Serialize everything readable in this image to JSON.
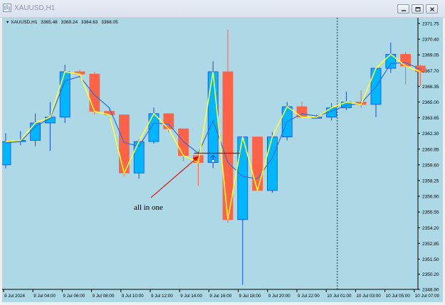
{
  "window": {
    "title": "XAUUSD,H1",
    "buttons": {
      "minimize": "minimize-icon",
      "restore": "restore-icon",
      "close": "close-icon"
    }
  },
  "header": {
    "symbol": "XAUUSD,H1",
    "open": "3365.48",
    "high": "3369.24",
    "low": "3364.63",
    "close": "3368.05"
  },
  "annotation": {
    "text": "all in one",
    "color": "#e00000"
  },
  "colors": {
    "background": "#add8e6",
    "bull_fill": "#00b7ff",
    "bear_fill": "#ff6347",
    "bull_wick": "#1a4ad6",
    "bear_wick": "#ff6347",
    "yellow_line": "#ffff33",
    "blue_line": "#2f6fd6",
    "grid": "#7a9aa8"
  },
  "chart_data": {
    "type": "candlestick",
    "y_ticks": [
      "2371.75",
      "2370.40",
      "2369.05",
      "2367.70",
      "2366.35",
      "2365.00",
      "2363.65",
      "2362.30",
      "2360.95",
      "2359.60",
      "2358.25",
      "2356.90",
      "2355.55",
      "2354.20",
      "2352.85",
      "2351.50",
      "2350.20",
      "2348.90"
    ],
    "x_ticks": [
      "9 Jul 2024",
      "9 Jul 04:00",
      "9 Jul 06:00",
      "9 Jul 08:00",
      "9 Jul 10:00",
      "9 Jul 12:00",
      "9 Jul 14:00",
      "9 Jul 16:00",
      "9 Jul 18:00",
      "9 Jul 20:00",
      "9 Jul 22:00",
      "10 Jul 01:00",
      "10 Jul 03:00",
      "10 Jul 05:00",
      "10 Jul 07:00"
    ],
    "ylim": [
      2348.9,
      2371.75
    ],
    "candles": [
      {
        "o": 2359.6,
        "h": 2362.3,
        "l": 2359.3,
        "c": 2361.6
      },
      {
        "o": 2361.6,
        "h": 2362.5,
        "l": 2361.3,
        "c": 2361.7
      },
      {
        "o": 2361.7,
        "h": 2364.0,
        "l": 2361.2,
        "c": 2363.2
      },
      {
        "o": 2363.2,
        "h": 2365.0,
        "l": 2360.8,
        "c": 2363.7
      },
      {
        "o": 2363.7,
        "h": 2368.2,
        "l": 2363.2,
        "c": 2367.6
      },
      {
        "o": 2367.6,
        "h": 2367.8,
        "l": 2367.1,
        "c": 2367.4
      },
      {
        "o": 2367.4,
        "h": 2367.6,
        "l": 2363.9,
        "c": 2364.2
      },
      {
        "o": 2364.2,
        "h": 2364.5,
        "l": 2363.6,
        "c": 2363.9
      },
      {
        "o": 2363.9,
        "h": 2363.9,
        "l": 2358.6,
        "c": 2358.9
      },
      {
        "o": 2358.9,
        "h": 2361.8,
        "l": 2358.4,
        "c": 2361.6
      },
      {
        "o": 2361.6,
        "h": 2364.5,
        "l": 2361.4,
        "c": 2364.0
      },
      {
        "o": 2364.0,
        "h": 2364.0,
        "l": 2362.4,
        "c": 2362.7
      },
      {
        "o": 2362.7,
        "h": 2362.7,
        "l": 2359.9,
        "c": 2360.4
      },
      {
        "o": 2360.4,
        "h": 2360.7,
        "l": 2357.8,
        "c": 2359.8
      },
      {
        "o": 2359.8,
        "h": 2368.5,
        "l": 2359.3,
        "c": 2367.6
      },
      {
        "o": 2367.6,
        "h": 2371.2,
        "l": 2354.6,
        "c": 2354.9
      },
      {
        "o": 2354.9,
        "h": 2362.0,
        "l": 2349.3,
        "c": 2362.0
      },
      {
        "o": 2362.0,
        "h": 2362.0,
        "l": 2357.2,
        "c": 2357.4
      },
      {
        "o": 2357.4,
        "h": 2362.4,
        "l": 2357.2,
        "c": 2362.0
      },
      {
        "o": 2362.0,
        "h": 2365.0,
        "l": 2361.7,
        "c": 2364.6
      },
      {
        "o": 2364.6,
        "h": 2365.0,
        "l": 2363.7,
        "c": 2363.7
      },
      {
        "o": 2363.7,
        "h": 2363.9,
        "l": 2363.6,
        "c": 2363.7
      },
      {
        "o": 2363.7,
        "h": 2364.9,
        "l": 2363.4,
        "c": 2364.5
      },
      {
        "o": 2364.5,
        "h": 2365.9,
        "l": 2364.3,
        "c": 2365.0
      },
      {
        "o": 2365.0,
        "h": 2366.0,
        "l": 2364.5,
        "c": 2364.8
      },
      {
        "o": 2364.8,
        "h": 2367.9,
        "l": 2363.7,
        "c": 2367.9
      },
      {
        "o": 2367.9,
        "h": 2370.1,
        "l": 2367.5,
        "c": 2369.1
      },
      {
        "o": 2369.1,
        "h": 2369.3,
        "l": 2366.5,
        "c": 2368.1
      },
      {
        "o": 2368.1,
        "h": 2368.2,
        "l": 2366.4,
        "c": 2367.6
      }
    ],
    "yellow_line": [
      2361.6,
      2361.7,
      2363.2,
      2363.7,
      2367.6,
      2367.4,
      2364.2,
      2363.9,
      2358.9,
      2361.6,
      2364.0,
      2362.7,
      2360.4,
      2359.8,
      2367.6,
      2354.9,
      2362.0,
      2357.4,
      2362.0,
      2364.6,
      2363.7,
      2363.7,
      2364.5,
      2365.0,
      2364.8,
      2367.9,
      2369.1,
      2368.1,
      2367.6
    ],
    "blue_line": [
      2361.5,
      2361.6,
      2362.9,
      2363.6,
      2366.8,
      2367.2,
      2365.6,
      2364.5,
      2361.5,
      2361.2,
      2363.2,
      2363.1,
      2361.6,
      2360.6,
      2363.4,
      2359.8,
      2358.6,
      2358.4,
      2360.2,
      2363.3,
      2364.0,
      2363.8,
      2364.2,
      2364.7,
      2364.9,
      2366.3,
      2368.3,
      2368.4,
      2367.8
    ],
    "marker_line": {
      "price": 2360.6,
      "from_index": 13,
      "to_index": 16
    },
    "marker_arrow_index": 14,
    "vline_index": 22
  }
}
